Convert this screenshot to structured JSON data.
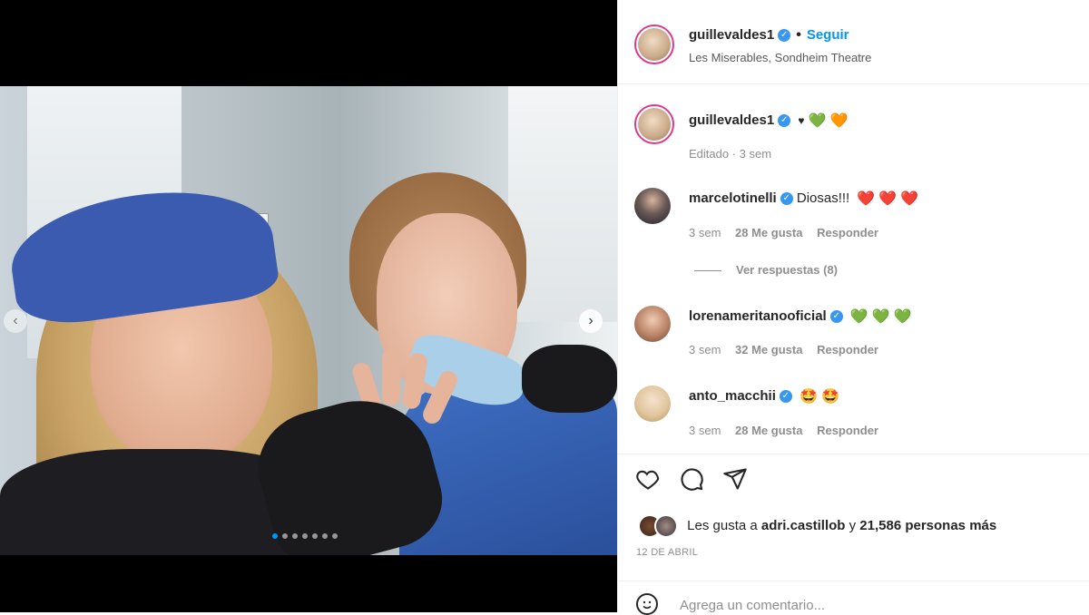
{
  "post": {
    "author": "guillevaldes1",
    "follow_label": "Seguir",
    "location": "Les Miserables, Sondheim Theatre",
    "separator": "•"
  },
  "carousel": {
    "total_slides": 7,
    "active_slide": 1
  },
  "caption": {
    "username": "guillevaldes1",
    "hearts": [
      "♥",
      "💚",
      "🧡"
    ],
    "meta": "Editado · 3 sem"
  },
  "comments": [
    {
      "username": "marcelotinelli",
      "text": "Diosas!!!",
      "emojis": [
        "❤️",
        "❤️",
        "❤️"
      ],
      "time": "3 sem",
      "likes": "28 Me gusta",
      "reply": "Responder"
    },
    {
      "username": "lorenameritanooficial",
      "text": "",
      "emojis": [
        "💚",
        "💚",
        "💚"
      ],
      "time": "3 sem",
      "likes": "32 Me gusta",
      "reply": "Responder"
    },
    {
      "username": "anto_macchii",
      "text": "",
      "emojis": [
        "🤩",
        "🤩"
      ],
      "time": "3 sem",
      "likes": "28 Me gusta",
      "reply": "Responder"
    }
  ],
  "view_replies": "Ver respuestas (8)",
  "likes": {
    "prefix": "Les gusta a",
    "user": "adri.castillob",
    "middle": "y",
    "count": "21,586 personas más"
  },
  "date": "12 DE ABRIL",
  "comment_box": {
    "placeholder": "Agrega un comentario..."
  },
  "colors": {
    "link_blue": "#0095f6",
    "verified_blue": "#3897f0",
    "text_gray": "#8e8e8e"
  },
  "icons": [
    "like-icon",
    "comment-icon",
    "share-icon",
    "emoji-icon",
    "next-arrow-icon",
    "prev-arrow-icon",
    "verified-icon"
  ]
}
